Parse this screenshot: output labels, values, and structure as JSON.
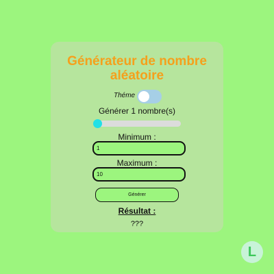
{
  "app": {
    "title": "Générateur de nombre aléatoire",
    "theme_label": "Théme :",
    "count_label": "Générer 1 nombre(s)",
    "count_value": 1,
    "minimum_label": "Minimum :",
    "minimum_value": "1",
    "maximum_label": "Maximum :",
    "maximum_value": "10",
    "generate_label": "Générer",
    "result_label": "Résultat :",
    "result_value": "???"
  },
  "logo": {
    "glyph": "L",
    "icon": "app-logo-icon"
  },
  "colors": {
    "background": "#9cf57e",
    "card": "#b6e59d",
    "title": "#f5a01c",
    "toggle": "#a6cfe6",
    "slider_thumb": "#22e0e6",
    "logo": "#3cc75a"
  }
}
